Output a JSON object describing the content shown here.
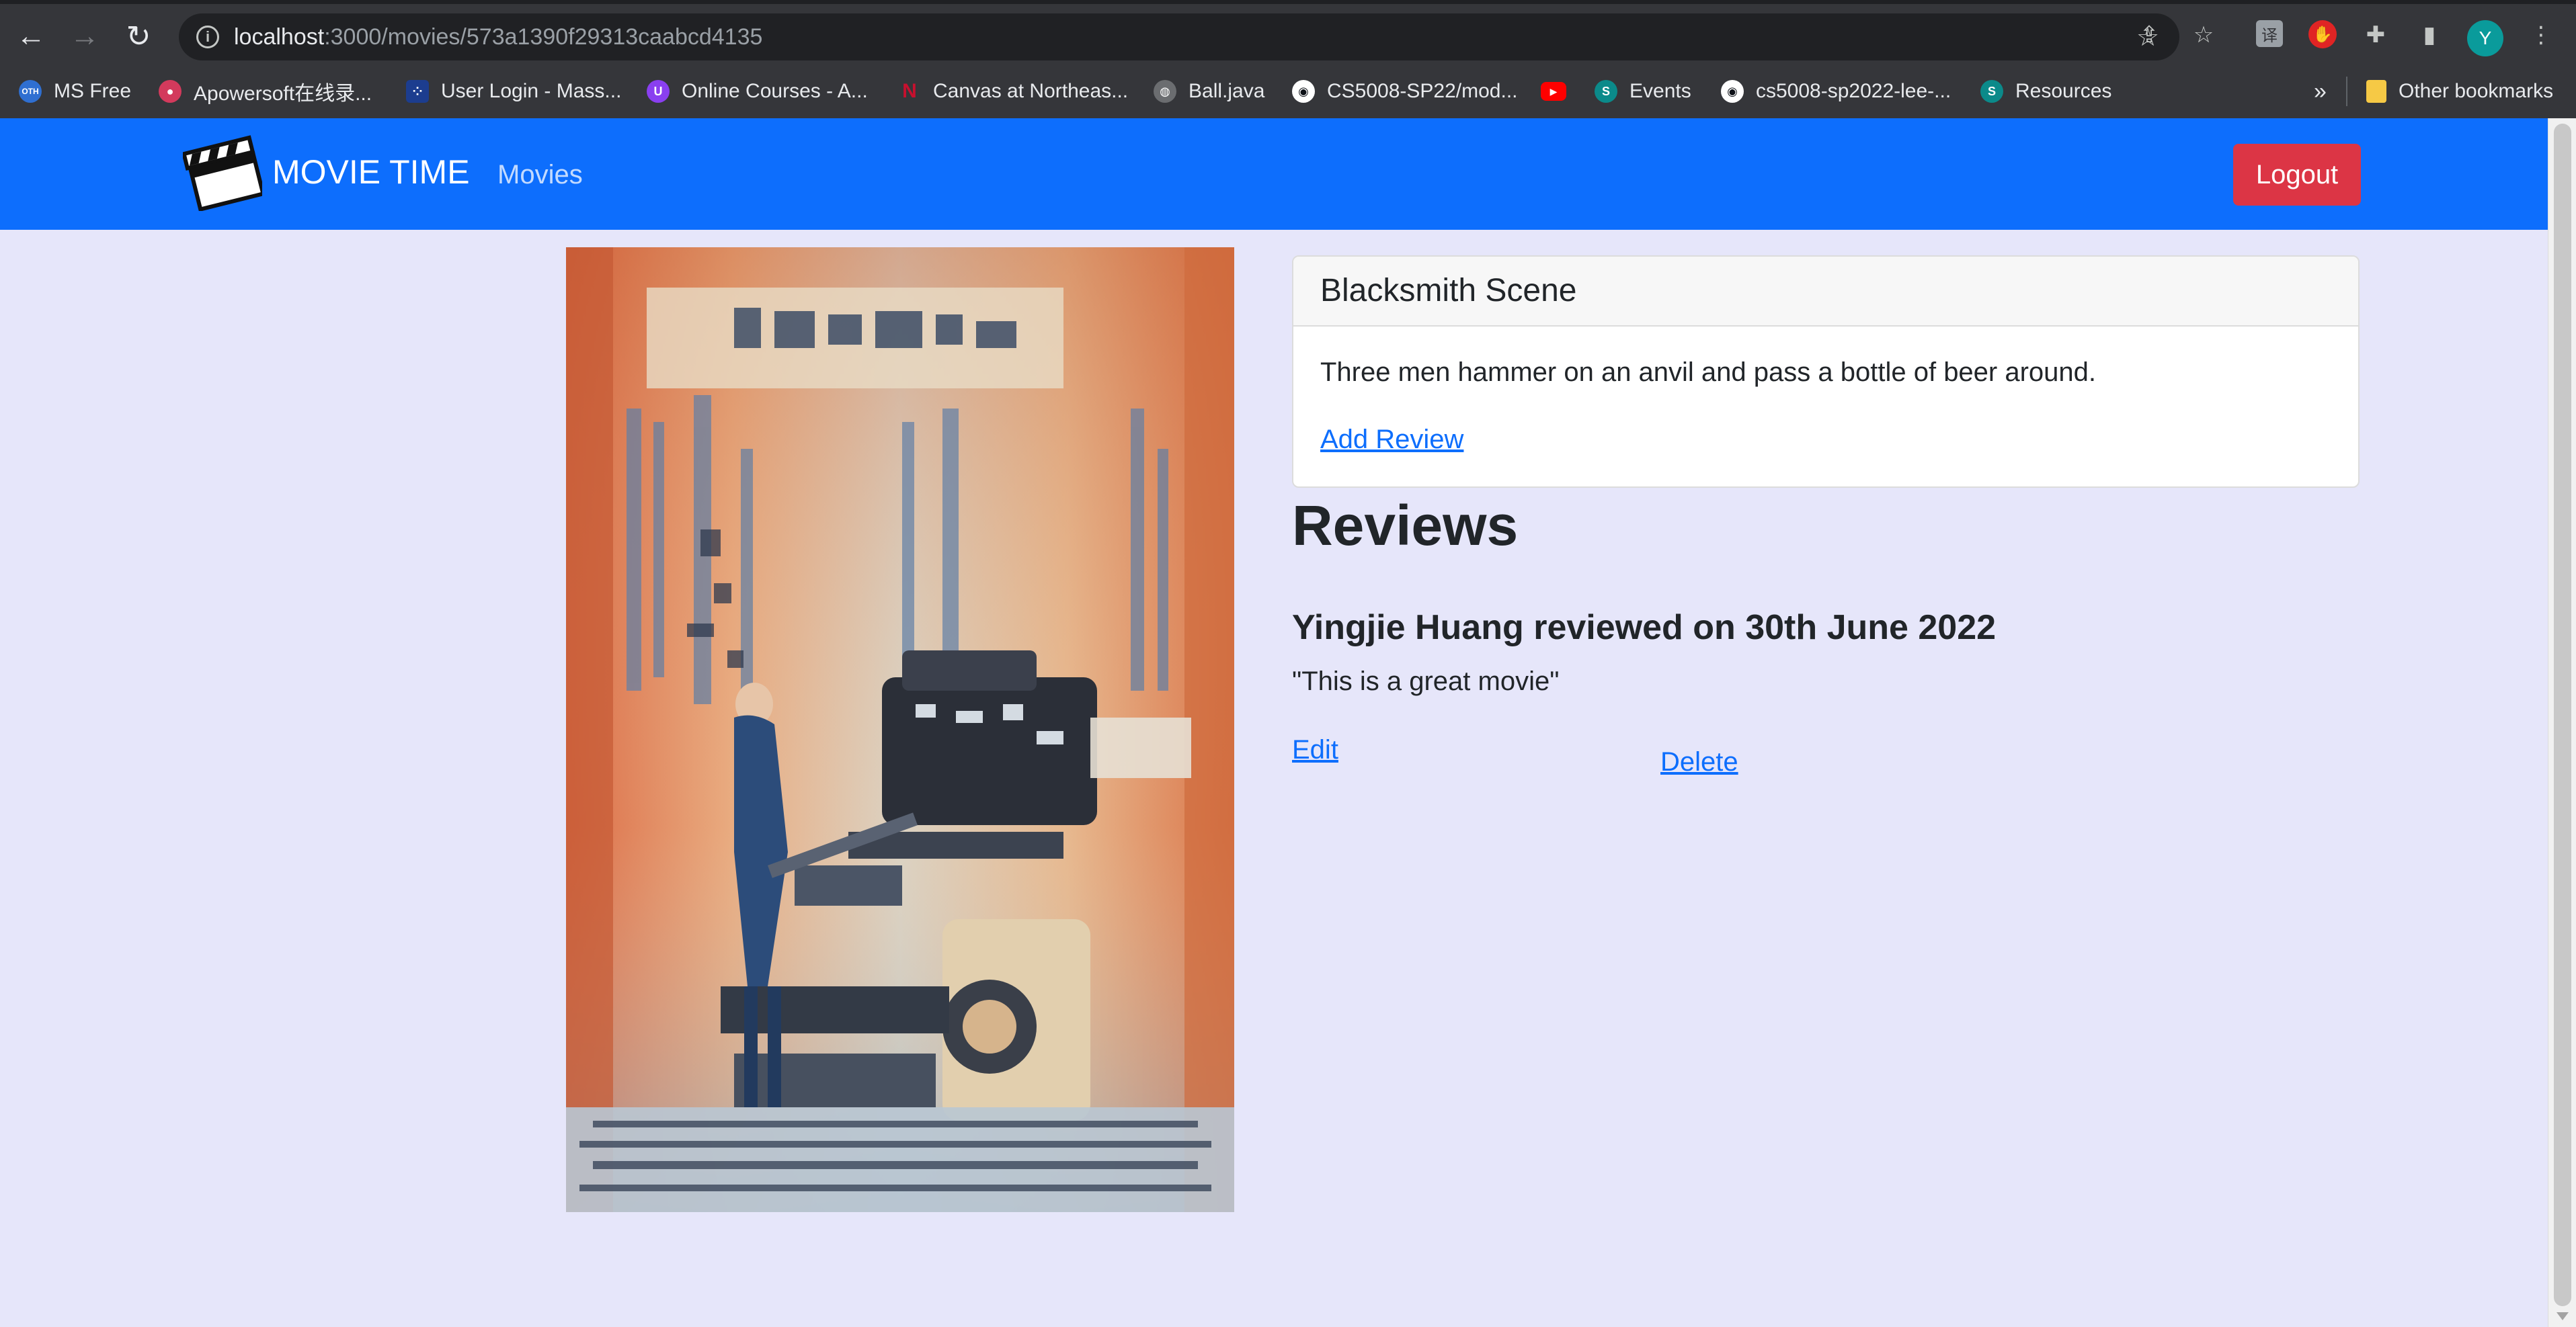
{
  "browser": {
    "url_host": "localhost",
    "url_path": ":3000/movies/573a1390f29313caabcd4135",
    "avatar_letter": "Y",
    "bookmarks": [
      {
        "label": "MS Free",
        "icon": "oth-icon",
        "color": "#2f6fd1"
      },
      {
        "label": "Apowersoft在线录...",
        "icon": "apowersoft-icon",
        "color": "#d33a5c"
      },
      {
        "label": "User Login - Mass...",
        "icon": "mass-icon",
        "color": "#1c3d8f"
      },
      {
        "label": "Online Courses - A...",
        "icon": "courses-icon",
        "color": "#8a3ff0"
      },
      {
        "label": "Canvas at Northeas...",
        "icon": "northeastern-icon",
        "color": "#c8102e"
      },
      {
        "label": "Ball.java",
        "icon": "globe-icon",
        "color": "#6b6d70"
      },
      {
        "label": "CS5008-SP22/mod...",
        "icon": "github-icon",
        "color": "#0d1117"
      },
      {
        "label": "",
        "icon": "youtube-icon",
        "color": "#ff0000"
      },
      {
        "label": "Events",
        "icon": "sharepoint-icon",
        "color": "#0b8a8a"
      },
      {
        "label": "cs5008-sp2022-lee-...",
        "icon": "github-icon",
        "color": "#0d1117"
      },
      {
        "label": "Resources",
        "icon": "sharepoint-icon",
        "color": "#0b8a8a"
      }
    ],
    "other_bookmarks": "Other bookmarks",
    "overflow": "»"
  },
  "navbar": {
    "brand": "MOVIE TIME",
    "movies_link": "Movies",
    "logout_label": "Logout"
  },
  "movie": {
    "title": "Blacksmith Scene",
    "plot": "Three men hammer on an anvil and pass a bottle of beer around.",
    "add_review_label": "Add Review"
  },
  "reviews": {
    "heading": "Reviews",
    "items": [
      {
        "header": "Yingjie Huang reviewed on 30th June 2022",
        "text": "\"This is a great movie\"",
        "edit_label": "Edit",
        "delete_label": "Delete"
      }
    ]
  },
  "colors": {
    "page_bg": "#e6e6fa",
    "navbar_bg": "#0d6efd",
    "logout_bg": "#dc3545",
    "link": "#0d6efd"
  }
}
